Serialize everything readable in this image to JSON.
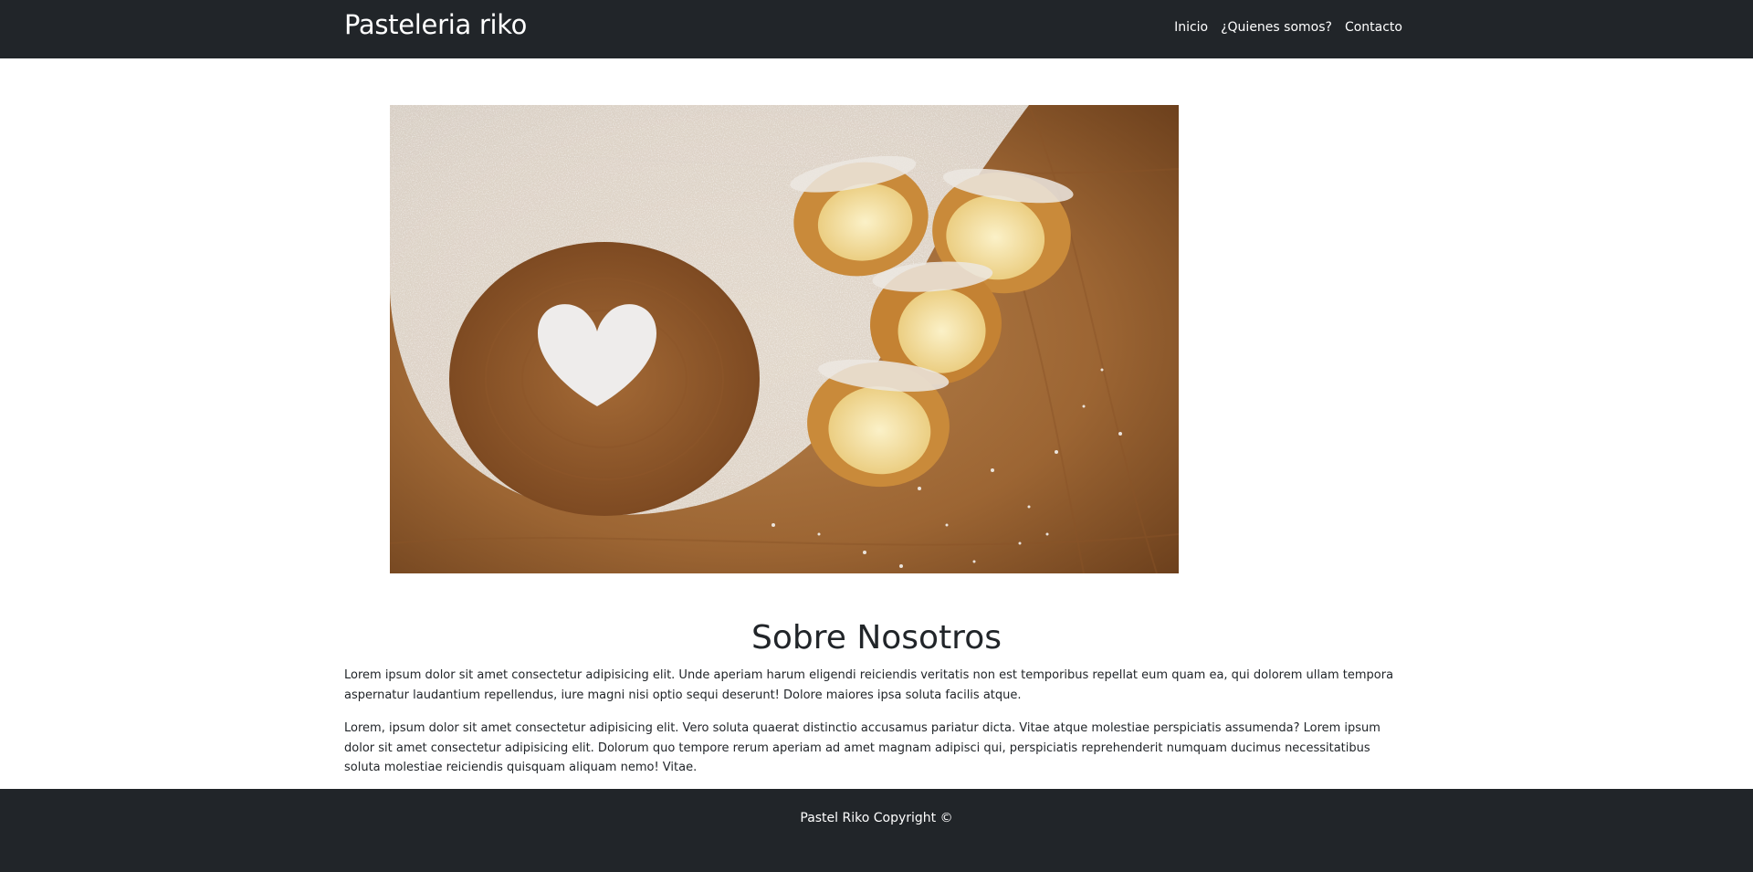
{
  "navbar": {
    "brand": "Pasteleria riko",
    "links": [
      "Inicio",
      "¿Quienes somos?",
      "Contacto"
    ]
  },
  "hero": {
    "icon": "pastry-photo",
    "colors": {
      "wood_light": "#b07a45",
      "wood_dark": "#6b3f1c",
      "sugar": "#f2f2f2",
      "pastry_crust": "#c98a3a",
      "cream": "#f6e6b0"
    }
  },
  "about": {
    "title": "Sobre Nosotros",
    "paragraph1": "Lorem ipsum dolor sit amet consectetur adipisicing elit. Unde aperiam harum eligendi reiciendis veritatis non est temporibus repellat eum quam ea, qui dolorem ullam tempora aspernatur laudantium repellendus, iure magni nisi optio sequi deserunt! Dolore maiores ipsa soluta facilis atque.",
    "paragraph2": "Lorem, ipsum dolor sit amet consectetur adipisicing elit. Vero soluta quaerat distinctio accusamus pariatur dicta. Vitae atque molestiae perspiciatis assumenda? Lorem ipsum dolor sit amet consectetur adipisicing elit. Dolorum quo tempore rerum aperiam ad amet magnam adipisci qui, perspiciatis reprehenderit numquam ducimus necessitatibus soluta molestiae reiciendis quisquam aliquam nemo! Vitae."
  },
  "footer": {
    "text": "Pastel Riko Copyright ©"
  },
  "theme": {
    "dark": "#212529",
    "light": "#ffffff"
  }
}
